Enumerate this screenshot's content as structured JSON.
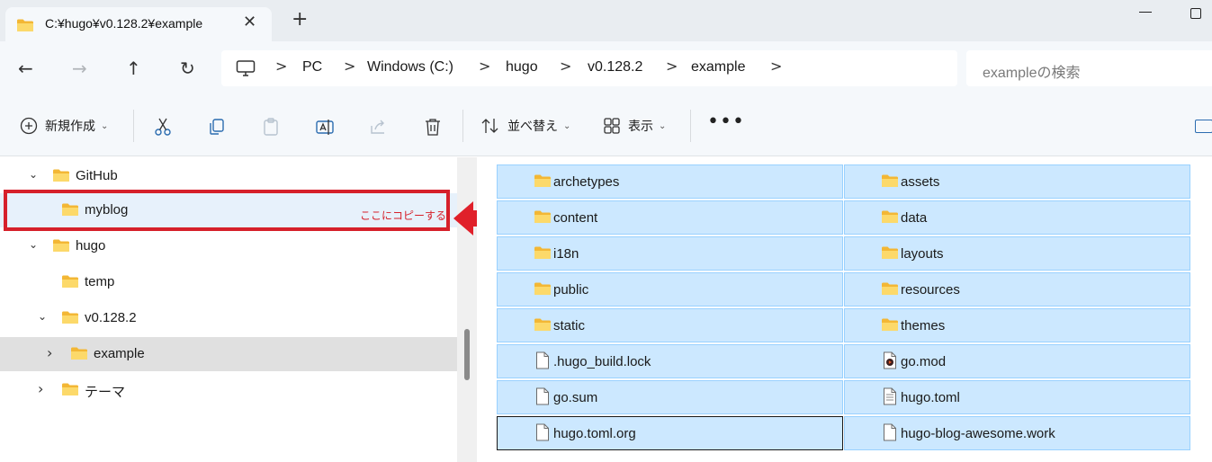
{
  "window": {
    "tab_title": "C:¥hugo¥v0.128.2¥example",
    "close_glyph": "✕",
    "new_tab_glyph": "+"
  },
  "nav": {
    "back_glyph": "←",
    "forward_glyph": "→",
    "up_glyph": "↑",
    "refresh_glyph": "↻",
    "breadcrumbs": [
      "PC",
      "Windows (C:)",
      "hugo",
      "v0.128.2",
      "example"
    ],
    "separator": ">",
    "search_placeholder": "exampleの検索"
  },
  "toolbar": {
    "new_label": "新規作成",
    "sort_label": "並べ替え",
    "view_label": "表示",
    "more_glyph": "•••",
    "caret_glyph": "⌄"
  },
  "tree": {
    "items": [
      {
        "label": "GitHub",
        "chevron": "⌄"
      },
      {
        "label": "myblog",
        "chevron": ""
      },
      {
        "label": "hugo",
        "chevron": "⌄"
      },
      {
        "label": "temp",
        "chevron": ""
      },
      {
        "label": "v0.128.2",
        "chevron": "⌄"
      },
      {
        "label": "example",
        "chevron": "›"
      },
      {
        "label": "テーマ",
        "chevron": "›"
      }
    ],
    "annotation": "ここにコピーする"
  },
  "files": [
    {
      "name": "archetypes",
      "type": "folder"
    },
    {
      "name": "assets",
      "type": "folder"
    },
    {
      "name": "content",
      "type": "folder"
    },
    {
      "name": "data",
      "type": "folder"
    },
    {
      "name": "i18n",
      "type": "folder"
    },
    {
      "name": "layouts",
      "type": "folder"
    },
    {
      "name": "public",
      "type": "folder"
    },
    {
      "name": "resources",
      "type": "folder"
    },
    {
      "name": "static",
      "type": "folder"
    },
    {
      "name": "themes",
      "type": "folder"
    },
    {
      "name": ".hugo_build.lock",
      "type": "file"
    },
    {
      "name": "go.mod",
      "type": "media-file"
    },
    {
      "name": "go.sum",
      "type": "file"
    },
    {
      "name": "hugo.toml",
      "type": "text-file"
    },
    {
      "name": "hugo.toml.org",
      "type": "file"
    },
    {
      "name": "hugo-blog-awesome.work",
      "type": "file"
    }
  ],
  "colors": {
    "selection": "#cce8ff",
    "selection_border": "#99d1ff",
    "annotation": "#d6202a",
    "folder": "#f8c94a"
  }
}
